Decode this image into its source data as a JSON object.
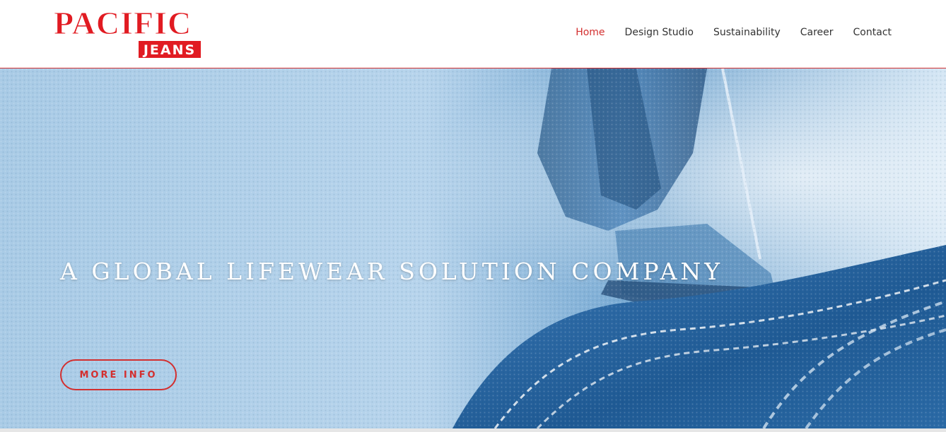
{
  "logo": {
    "line1": "PACIFIC",
    "line2": "JEANS",
    "brand_color": "#e11b22"
  },
  "nav": {
    "items": [
      {
        "label": "Home",
        "active": true
      },
      {
        "label": "Design Studio",
        "active": false
      },
      {
        "label": "Sustainability",
        "active": false
      },
      {
        "label": "Career",
        "active": false
      },
      {
        "label": "Contact",
        "active": false
      }
    ]
  },
  "hero": {
    "title": "A GLOBAL LIFEWEAR SOLUTION COMPANY",
    "button_label": "MORE INFO",
    "image": "denim-sewing-machine-photo"
  },
  "colors": {
    "accent": "#d32f2f",
    "nav_text": "#333333",
    "hero_blue": "#2a6fb0"
  }
}
